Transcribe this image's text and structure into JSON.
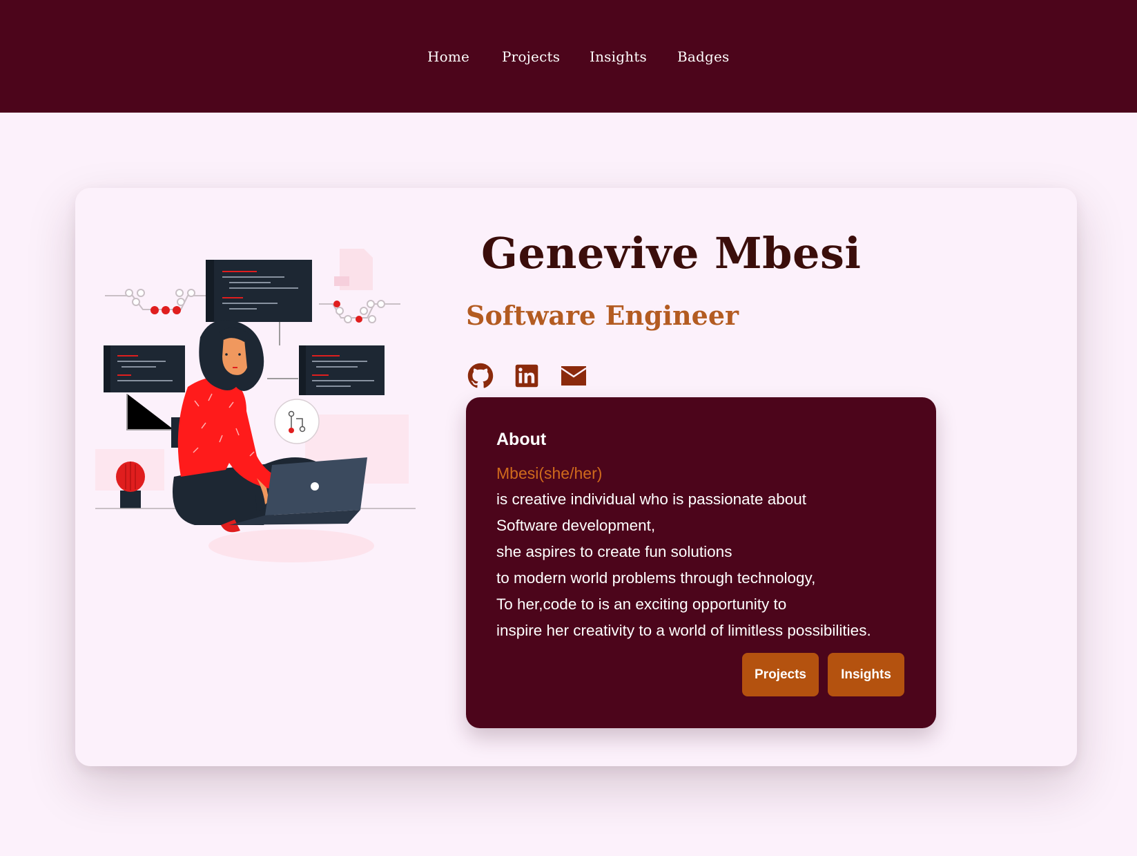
{
  "nav": {
    "items": [
      {
        "label": "Home"
      },
      {
        "label": "Projects"
      },
      {
        "label": "Insights"
      },
      {
        "label": "Badges"
      }
    ]
  },
  "profile": {
    "name": "Genevive Mbesi",
    "role": "Software Engineer"
  },
  "social": {
    "icons": [
      "github-icon",
      "linkedin-icon",
      "email-icon"
    ],
    "color": "#8b2a0c"
  },
  "about": {
    "title": "About",
    "pronoun": "Mbesi(she/her)",
    "lines": [
      "is creative individual who is passionate about",
      "Software development,",
      "she aspires to create fun solutions",
      "to modern world problems through technology,",
      "To her,code to is an exciting opportunity to",
      "inspire her creativity to a world of limitless possibilities."
    ],
    "buttons": {
      "projects": "Projects",
      "insights": "Insights"
    }
  },
  "colors": {
    "header": "#4c051b",
    "background": "#fcf1fb",
    "accent": "#b4520f",
    "name": "#3b0e0b",
    "role": "#b35b21"
  }
}
